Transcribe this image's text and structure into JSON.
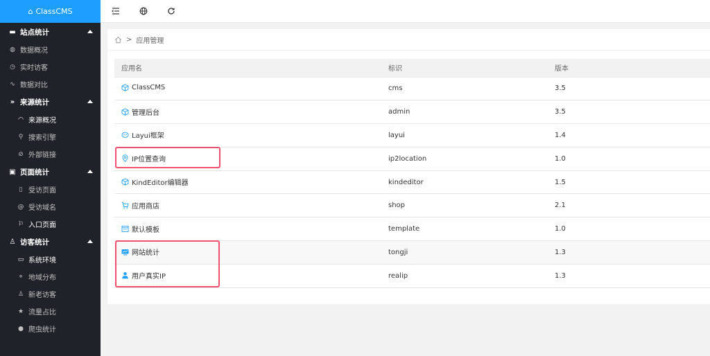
{
  "brand": {
    "name": "ClassCMS"
  },
  "sidebar": {
    "groups": [
      {
        "label": "站点统计",
        "icon": "monitor-icon",
        "items": [
          {
            "label": "数据概况",
            "icon": "globe-icon"
          },
          {
            "label": "实时访客",
            "icon": "clock-icon"
          },
          {
            "label": "数据对比",
            "icon": "pulse-icon"
          }
        ]
      },
      {
        "label": "来源统计",
        "icon": "double-chevron-icon",
        "items": [
          {
            "label": "来源概况",
            "icon": "gauge-icon"
          },
          {
            "label": "搜索引擎",
            "icon": "search-icon"
          },
          {
            "label": "外部链接",
            "icon": "link-icon"
          }
        ]
      },
      {
        "label": "页面统计",
        "icon": "layout-icon",
        "items": [
          {
            "label": "受访页面",
            "icon": "file-icon"
          },
          {
            "label": "受访域名",
            "icon": "at-icon"
          },
          {
            "label": "入口页面",
            "icon": "flag-icon"
          }
        ]
      },
      {
        "label": "访客统计",
        "icon": "user-icon",
        "items": [
          {
            "label": "系统环境",
            "icon": "display-icon"
          },
          {
            "label": "地域分布",
            "icon": "location-icon"
          },
          {
            "label": "新老访客",
            "icon": "users-icon"
          },
          {
            "label": "流量占比",
            "icon": "star-icon"
          },
          {
            "label": "爬虫统计",
            "icon": "android-icon"
          }
        ]
      }
    ]
  },
  "toolbar": {
    "menu_toggle": "menu-toggle-icon",
    "website": "globe-icon",
    "refresh": "refresh-icon"
  },
  "breadcrumb": {
    "separator": ">",
    "current": "应用管理"
  },
  "table": {
    "headers": [
      "应用名",
      "标识",
      "版本"
    ],
    "rows": [
      {
        "name": "ClassCMS",
        "id": "cms",
        "version": "3.5",
        "icon": "cube-icon"
      },
      {
        "name": "管理后台",
        "id": "admin",
        "version": "3.5",
        "icon": "cube-icon"
      },
      {
        "name": "Layui框架",
        "id": "layui",
        "version": "1.4",
        "icon": "layui-icon"
      },
      {
        "name": "IP位置查询",
        "id": "ip2location",
        "version": "1.0",
        "icon": "location-icon"
      },
      {
        "name": "KindEditor编辑器",
        "id": "kindeditor",
        "version": "1.5",
        "icon": "cube-icon"
      },
      {
        "name": "应用商店",
        "id": "shop",
        "version": "2.1",
        "icon": "cart-icon"
      },
      {
        "name": "默认模板",
        "id": "template",
        "version": "1.0",
        "icon": "template-icon"
      },
      {
        "name": "网站统计",
        "id": "tongji",
        "version": "1.3",
        "icon": "chart-icon"
      },
      {
        "name": "用户真实IP",
        "id": "realip",
        "version": "1.3",
        "icon": "person-icon"
      }
    ]
  },
  "colors": {
    "accent": "#1e9fff",
    "sidebar": "#20222a",
    "highlight": "#f0506e"
  }
}
